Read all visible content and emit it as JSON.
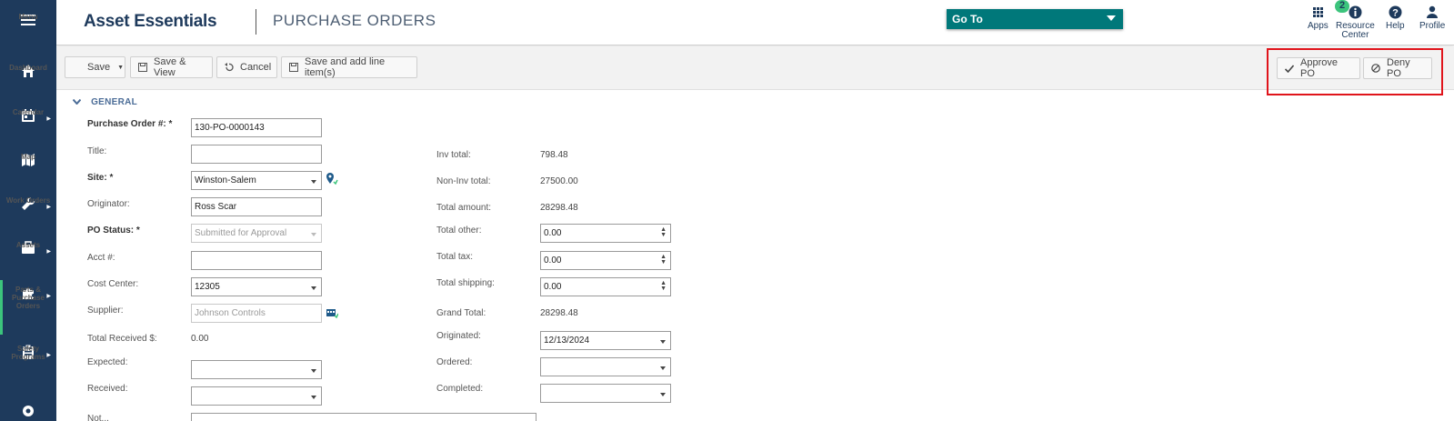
{
  "sidebar": {
    "menu_label": "Menu",
    "items": [
      {
        "label": "Dashboard",
        "icon": "home-icon"
      },
      {
        "label": "Calendar",
        "icon": "calendar-icon"
      },
      {
        "label": "Map",
        "icon": "map-icon"
      },
      {
        "label": "Work Orders",
        "icon": "wrench-icon"
      },
      {
        "label": "Assets",
        "icon": "briefcase-icon"
      },
      {
        "label": "Parts & Purchase Orders",
        "icon": "puzzle-icon"
      },
      {
        "label": "Safety Programs",
        "icon": "clipboard-icon"
      }
    ]
  },
  "header": {
    "brand": "Asset Essentials",
    "page_title": "PURCHASE ORDERS",
    "goto_label": "Go To",
    "apps_label": "Apps",
    "apps_badge": "2",
    "resource_label_1": "Resource",
    "resource_label_2": "Center",
    "help_label": "Help",
    "profile_label": "Profile"
  },
  "toolbar": {
    "save": "Save",
    "save_view": "Save & View",
    "cancel": "Cancel",
    "save_add": "Save and add line item(s)",
    "approve": "Approve PO",
    "deny": "Deny PO"
  },
  "form": {
    "section": "GENERAL",
    "po_number_label": "Purchase Order #: *",
    "po_number": "130-PO-0000143",
    "title_label": "Title:",
    "title_value": "",
    "site_label": "Site: *",
    "site_value": "Winston-Salem",
    "originator_label": "Originator:",
    "originator_value": "Ross  Scar",
    "status_label": "PO Status: *",
    "status_value": "Submitted for Approval",
    "acct_label": "Acct #:",
    "acct_value": "",
    "cost_center_label": "Cost Center:",
    "cost_center_value": "12305",
    "supplier_label": "Supplier:",
    "supplier_value": "Johnson Controls",
    "total_received_label": "Total Received $:",
    "total_received_value": "0.00",
    "expected_label": "Expected:",
    "received_label": "Received:",
    "notes_label": "Not...",
    "inv_total_label": "Inv total:",
    "inv_total_value": "798.48",
    "non_inv_total_label": "Non-Inv total:",
    "non_inv_total_value": "27500.00",
    "total_amount_label": "Total amount:",
    "total_amount_value": "28298.48",
    "total_other_label": "Total other:",
    "total_other_value": "0.00",
    "total_tax_label": "Total tax:",
    "total_tax_value": "0.00",
    "total_shipping_label": "Total shipping:",
    "total_shipping_value": "0.00",
    "grand_total_label": "Grand Total:",
    "grand_total_value": "28298.48",
    "originated_label": "Originated:",
    "originated_value": "12/13/2024",
    "ordered_label": "Ordered:",
    "completed_label": "Completed:"
  },
  "colors": {
    "sidebar_bg": "#1e3a5c",
    "accent_green": "#3cc47c",
    "goto_teal": "#00787a",
    "highlight_red": "#e0141b"
  }
}
